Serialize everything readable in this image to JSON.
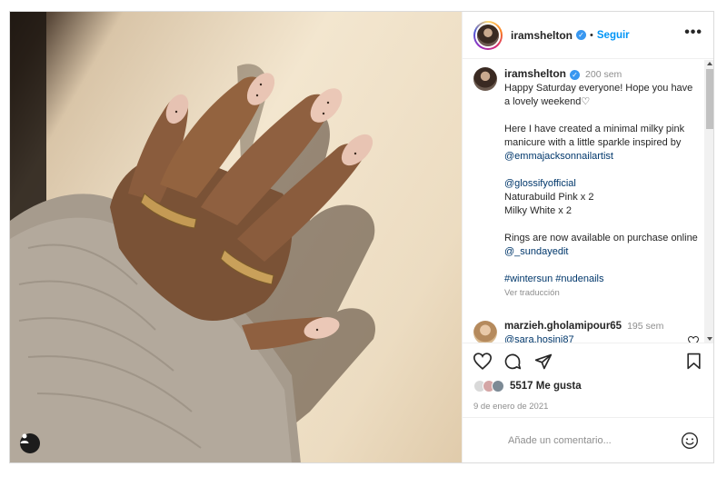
{
  "post": {
    "author": "iramshelton",
    "follow_label": "Seguir",
    "more_label": "•••",
    "caption": {
      "author": "iramshelton",
      "time": "200 sem",
      "lines": [
        "Happy Saturday everyone! Hope you have a lovely weekend♡",
        "Here I have created a minimal milky pink manicure with a little sparkle inspired by",
        "@emmajacksonnailartist",
        "@glossifyofficial",
        "Naturabuild Pink x 2",
        "Milky White x 2",
        "Rings are now available on purchase online",
        "@_sundayedit",
        "#wintersun",
        "#nudenails"
      ],
      "translate": "Ver traducción"
    },
    "comment": {
      "author": "marzieh.gholamipour65",
      "time": "195 sem",
      "mention": "@sara.hosini87"
    },
    "likes_label": "5517 Me gusta",
    "date": "9 de enero de 2021",
    "comment_placeholder": "Añade un comentario..."
  },
  "colors": {
    "accent": "#0095f6",
    "link": "#00376b",
    "muted": "#8e8e8e",
    "verified": "#3897f0"
  },
  "icons": [
    "heart-icon",
    "comment-icon",
    "share-icon",
    "bookmark-icon",
    "emoji-icon",
    "user-tag-icon",
    "verified-icon",
    "more-icon"
  ]
}
